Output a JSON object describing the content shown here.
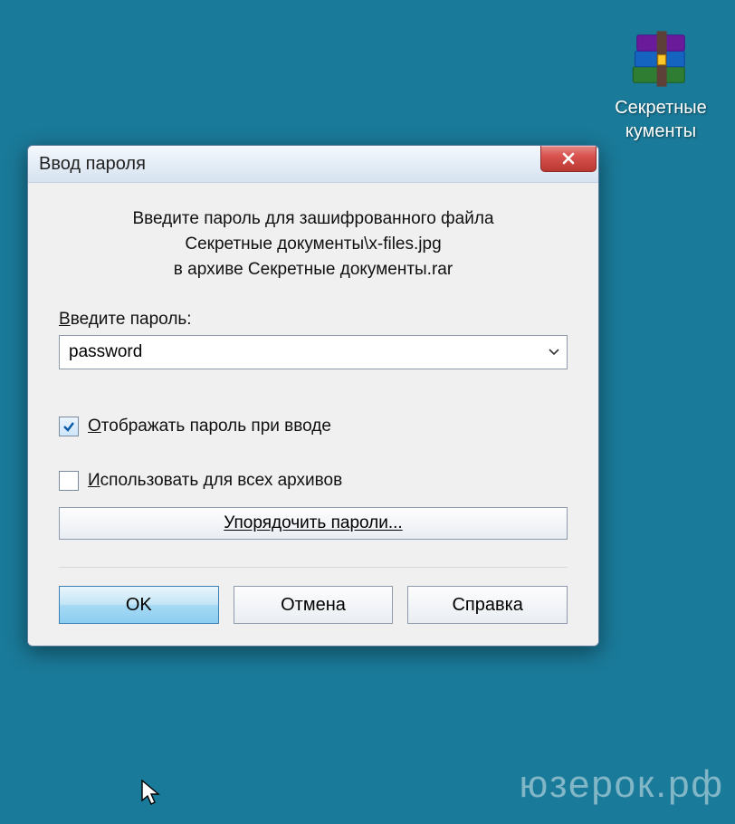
{
  "desktop": {
    "icon_label": "Секретные\nкументы"
  },
  "dialog": {
    "title": "Ввод пароля",
    "instructions": {
      "line1": "Введите пароль для зашифрованного файла",
      "line2": "Секретные документы\\x-files.jpg",
      "line3": "в архиве Секретные документы.rar"
    },
    "password_label": "Введите пароль:",
    "password_value": "password",
    "show_password_label": "Отображать пароль при вводе",
    "show_password_checked": true,
    "use_for_all_label": "Использовать для всех архивов",
    "use_for_all_checked": false,
    "organize_button": "Упорядочить пароли...",
    "ok_button": "OK",
    "cancel_button": "Отмена",
    "help_button": "Справка"
  },
  "watermark": "юзерок.рф"
}
